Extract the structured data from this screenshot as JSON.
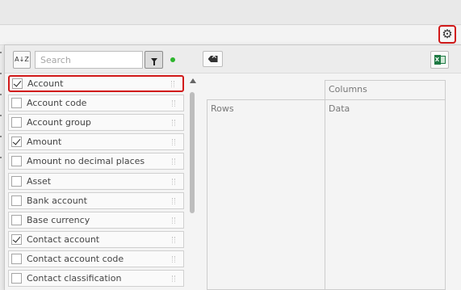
{
  "toolbar": {
    "search_placeholder": "Search",
    "sort_icon_text": "A↓Z"
  },
  "fields": [
    {
      "label": "Account",
      "checked": true,
      "highlighted": true
    },
    {
      "label": "Account code",
      "checked": false
    },
    {
      "label": "Account group",
      "checked": false
    },
    {
      "label": "Amount",
      "checked": true
    },
    {
      "label": "Amount no decimal places",
      "checked": false
    },
    {
      "label": "Asset",
      "checked": false
    },
    {
      "label": "Bank account",
      "checked": false
    },
    {
      "label": "Base currency",
      "checked": false
    },
    {
      "label": "Contact account",
      "checked": true
    },
    {
      "label": "Contact account code",
      "checked": false
    },
    {
      "label": "Contact classification",
      "checked": false
    }
  ],
  "pivot": {
    "columns_label": "Columns",
    "rows_label": "Rows",
    "data_label": "Data"
  },
  "colors": {
    "highlight": "#d11a1a",
    "status_dot": "#2db52d",
    "excel_green": "#1e7a44"
  },
  "icons": {
    "settings": "gear-icon",
    "sort": "sort-az-icon",
    "filter": "funnel-icon",
    "clear": "clear-backspace-icon",
    "export": "excel-icon"
  }
}
